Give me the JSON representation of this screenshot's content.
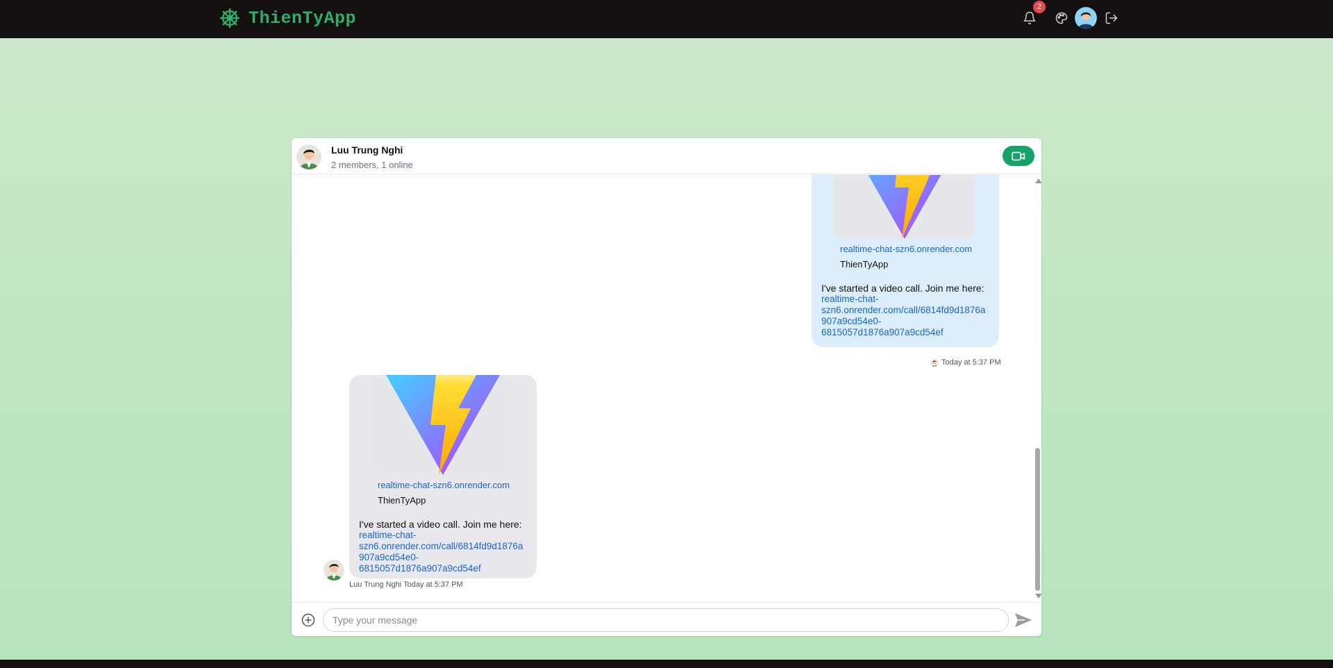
{
  "app": {
    "title": "ThienTyApp"
  },
  "navbar": {
    "notification_count": "2",
    "icons": [
      "dharma-wheel-icon",
      "bell-icon",
      "palette-icon",
      "avatar",
      "logout-icon"
    ]
  },
  "chat": {
    "name": "Luu Trung Nghi",
    "subtitle": "2 members, 1 online",
    "video_button_icon": "video-camera-icon"
  },
  "messages": [
    {
      "direction": "outgoing",
      "preview": {
        "domain": "realtime-chat-szn6.onrender.com",
        "site": "ThienTyApp"
      },
      "text": "I've started a video call. Join me here:",
      "link_lines": [
        "realtime-chat-",
        "szn6.onrender.com/call/6814fd9d1876a",
        "907a9cd54e0-",
        "6815057d1876a907a9cd54ef"
      ],
      "time": "Today at 5:37 PM"
    },
    {
      "direction": "incoming",
      "preview": {
        "domain": "realtime-chat-szn6.onrender.com",
        "site": "ThienTyApp"
      },
      "text": "I've started a video call. Join me here:",
      "link_lines": [
        "realtime-chat-",
        "szn6.onrender.com/call/6814fd9d1876a",
        "907a9cd54e0-",
        "6815057d1876a907a9cd54ef"
      ],
      "sender": "Luu Trung Nghi",
      "time": "Today at 5:37 PM"
    }
  ],
  "composer": {
    "placeholder": "Type your message"
  },
  "colors": {
    "navbar": "#141010",
    "brand": "#2fae6a",
    "accent": "#15a36a",
    "link": "#1565d8",
    "outgoing_bubble": "#dceefc",
    "incoming_bubble": "#e8e8ec",
    "badge": "#e5484d"
  }
}
